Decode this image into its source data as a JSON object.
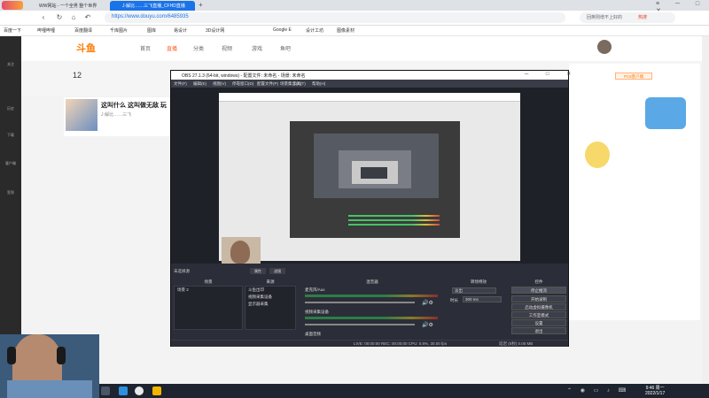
{
  "browser": {
    "tabs": [
      {
        "label": "WW网站 - 一个全男 整个世界"
      },
      {
        "label": "J·解比……三飞直播_CFHD直播"
      }
    ],
    "url": "https://www.douyu.com/6485935",
    "search_placeholder": "回英则增不上好的",
    "search_badge": "热搜",
    "bookmarks": [
      "百度一下",
      "哔哩哔哩",
      "百度翻译",
      "千库图片",
      "图库",
      "易设计",
      "3D设计网",
      "Google E",
      "设计工坊",
      "图像素材"
    ]
  },
  "site": {
    "logo": "斗鱼",
    "nav": [
      "首页",
      "直播",
      "分类",
      "视频",
      "游戏",
      "鱼吧"
    ],
    "stat_value": "12",
    "room_title": "这叫什么 这叫做无敌 玩",
    "room_sub": "J·解比……三飞",
    "left_rail": [
      "关注",
      "历史",
      "下载",
      "客户端",
      "签到"
    ],
    "right_widget_text": "PC8客户端"
  },
  "obs": {
    "title": "OBS 27.1.3 (64-bit, windows) - 配置文件: 未命名 - 场景: 未命名",
    "menu": [
      "文件(F)",
      "编辑(E)",
      "视图(V)",
      "停靠窗口(D)",
      "配置文件(P)",
      "场景集合(S)",
      "工具(T)",
      "帮助(H)"
    ],
    "scene_label": "未选择源",
    "props_btn": "属性",
    "filter_btn": "滤镜",
    "docks": {
      "scenes": "场景",
      "sources": "来源",
      "mixer": "混音器",
      "transitions": "转场特效",
      "controls": "控件"
    },
    "scene_items": [
      "场景 2"
    ],
    "source_items": [
      "斗鱼出印",
      "视频采集设备",
      "显示器采集"
    ],
    "mixer_channels": [
      {
        "name": "麦克风/Aux"
      },
      {
        "name": "视频采集设备"
      },
      {
        "name": "桌面音频"
      }
    ],
    "transition": "淡出",
    "duration_label": "时长",
    "duration_value": "300 ms",
    "controls": [
      "停止推流",
      "开始录制",
      "启动虚拟摄像机",
      "工作室模式",
      "设置",
      "退出"
    ],
    "status": "LIVE: 00:00:00   REC: 00:00:00   CPU: 0.8%, 30.00 fps",
    "status_right": "延迟 (5秒) 0.00 MB"
  },
  "taskbar": {
    "time": "9:46 周一",
    "date": "2022/1/17"
  }
}
